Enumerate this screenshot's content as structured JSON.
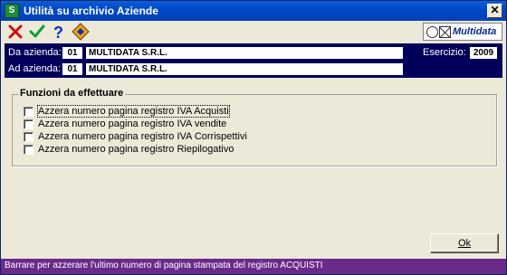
{
  "window": {
    "title": "Utilità su archivio Aziende",
    "close_glyph": "✕"
  },
  "toolbar": {
    "icons": [
      "close-x-icon",
      "confirm-check-icon",
      "help-icon",
      "utility-icon"
    ],
    "brand_text": "Multidata"
  },
  "header": {
    "from_label": "Da azienda:",
    "from_code": "01",
    "from_name": "MULTIDATA S.R.L.",
    "to_label": "Ad azienda:",
    "to_code": "01",
    "to_name": "MULTIDATA S.R.L.",
    "year_label": "Esercizio:",
    "year_value": "2009"
  },
  "group": {
    "title": "Funzioni da effettuare",
    "options": [
      {
        "label": "Azzera numero pagina registro IVA Acquisti",
        "checked": false
      },
      {
        "label": "Azzera numero pagina registro IVA vendite",
        "checked": false
      },
      {
        "label": "Azzera numero pagina registro IVA Corrispettivi",
        "checked": false
      },
      {
        "label": "Azzera numero pagina registro Riepilogativo",
        "checked": false
      }
    ]
  },
  "ok_button": {
    "label": "Ok"
  },
  "status": {
    "text": "Barrare per azzerare l'ultimo numero di pagina stampata del registro ACQUISTI",
    "color": "#6a2a8a"
  },
  "colors": {
    "title_bar": "#0048c8",
    "header_bg": "#00005a",
    "window_bg": "#ece9d8"
  }
}
